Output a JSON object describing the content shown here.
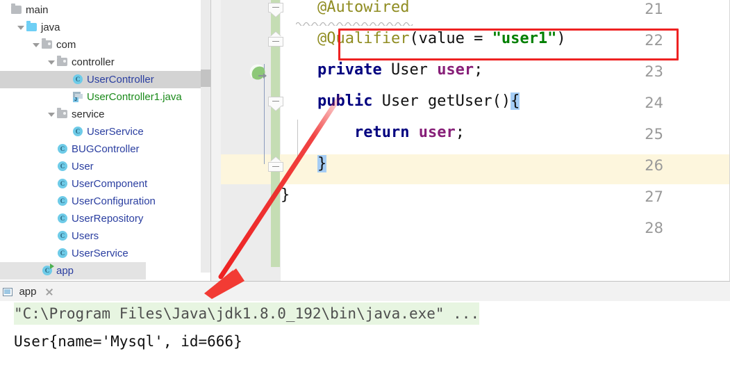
{
  "project_tree": {
    "name": "project-tree",
    "items": [
      {
        "label": "main",
        "icon": "folder-gray-icon",
        "indent": 0,
        "expanded": false,
        "twisty": false,
        "style": "dark",
        "selected": "none"
      },
      {
        "label": "java",
        "icon": "folder-source-icon",
        "indent": 1,
        "expanded": true,
        "twisty": true,
        "style": "dark",
        "selected": "none"
      },
      {
        "label": "com",
        "icon": "folder-package-icon",
        "indent": 2,
        "expanded": true,
        "twisty": true,
        "style": "dark",
        "selected": "none"
      },
      {
        "label": "controller",
        "icon": "folder-package-icon",
        "indent": 3,
        "expanded": true,
        "twisty": true,
        "style": "dark",
        "selected": "none"
      },
      {
        "label": "UserController",
        "icon": "class-icon",
        "indent": 4,
        "expanded": false,
        "twisty": false,
        "style": "blue",
        "selected": "full"
      },
      {
        "label": "UserController1.java",
        "icon": "java-file-icon",
        "indent": 4,
        "expanded": false,
        "twisty": false,
        "style": "green",
        "selected": "none"
      },
      {
        "label": "service",
        "icon": "folder-package-icon",
        "indent": 3,
        "expanded": true,
        "twisty": true,
        "style": "dark",
        "selected": "none"
      },
      {
        "label": "UserService",
        "icon": "class-icon",
        "indent": 4,
        "expanded": false,
        "twisty": false,
        "style": "blue",
        "selected": "none"
      },
      {
        "label": "BUGController",
        "icon": "class-icon",
        "indent": 3,
        "expanded": false,
        "twisty": false,
        "style": "blue",
        "selected": "none"
      },
      {
        "label": "User",
        "icon": "class-icon",
        "indent": 3,
        "expanded": false,
        "twisty": false,
        "style": "blue",
        "selected": "none"
      },
      {
        "label": "UserComponent",
        "icon": "class-icon",
        "indent": 3,
        "expanded": false,
        "twisty": false,
        "style": "blue",
        "selected": "none"
      },
      {
        "label": "UserConfiguration",
        "icon": "class-icon",
        "indent": 3,
        "expanded": false,
        "twisty": false,
        "style": "blue",
        "selected": "none"
      },
      {
        "label": "UserRepository",
        "icon": "class-icon",
        "indent": 3,
        "expanded": false,
        "twisty": false,
        "style": "blue",
        "selected": "none"
      },
      {
        "label": "Users",
        "icon": "class-icon",
        "indent": 3,
        "expanded": false,
        "twisty": false,
        "style": "blue",
        "selected": "none"
      },
      {
        "label": "UserService",
        "icon": "class-icon",
        "indent": 3,
        "expanded": false,
        "twisty": false,
        "style": "blue",
        "selected": "none"
      },
      {
        "label": "app",
        "icon": "class-runnable-icon",
        "indent": 2,
        "expanded": false,
        "twisty": false,
        "style": "blue",
        "selected": "light"
      }
    ]
  },
  "editor": {
    "name": "code-editor",
    "language": "java",
    "line_numbers": [
      "21",
      "22",
      "23",
      "24",
      "25",
      "26",
      "27",
      "28"
    ],
    "lines": [
      {
        "number": "21",
        "text": "    @Autowired",
        "tokens": [
          {
            "t": "    ",
            "c": "plain"
          },
          {
            "t": "@Autowired",
            "c": "annotation"
          }
        ],
        "gutter_icon": "fold-marker-down",
        "underlined": true
      },
      {
        "number": "22",
        "text": "    @Qualifier(value = \"user1\")",
        "tokens": [
          {
            "t": "    ",
            "c": "plain"
          },
          {
            "t": "@Qualifier",
            "c": "annotation"
          },
          {
            "t": "(value = ",
            "c": "plain"
          },
          {
            "t": "\"user1\"",
            "c": "string"
          },
          {
            "t": ")",
            "c": "plain"
          }
        ],
        "gutter_icon": "fold-marker-up",
        "highlighted_box": true
      },
      {
        "number": "23",
        "text": "    private User user;",
        "tokens": [
          {
            "t": "    ",
            "c": "plain"
          },
          {
            "t": "private",
            "c": "keyword"
          },
          {
            "t": " User ",
            "c": "plain"
          },
          {
            "t": "user",
            "c": "field"
          },
          {
            "t": ";",
            "c": "plain"
          }
        ],
        "gutter_icon": "spring-bean-icon"
      },
      {
        "number": "24",
        "text": "    public User getUser(){",
        "tokens": [
          {
            "t": "    ",
            "c": "plain"
          },
          {
            "t": "public",
            "c": "keyword"
          },
          {
            "t": " User getUser()",
            "c": "plain"
          },
          {
            "t": "{",
            "c": "brace-match"
          }
        ],
        "gutter_icon": "fold-marker-down"
      },
      {
        "number": "25",
        "text": "        return user;",
        "tokens": [
          {
            "t": "        ",
            "c": "plain"
          },
          {
            "t": "return",
            "c": "keyword"
          },
          {
            "t": " ",
            "c": "plain"
          },
          {
            "t": "user",
            "c": "field"
          },
          {
            "t": ";",
            "c": "plain"
          }
        ],
        "gutter_icon": ""
      },
      {
        "number": "26",
        "text": "    }",
        "tokens": [
          {
            "t": "    ",
            "c": "plain"
          },
          {
            "t": "}",
            "c": "brace-match"
          }
        ],
        "gutter_icon": "fold-marker-up",
        "current_line": true
      },
      {
        "number": "27",
        "text": "}",
        "tokens": [
          {
            "t": "}",
            "c": "plain"
          }
        ],
        "gutter_icon": ""
      },
      {
        "number": "28",
        "text": "",
        "tokens": [],
        "gutter_icon": ""
      }
    ]
  },
  "console": {
    "name": "run-console",
    "tab": {
      "label": "app",
      "icon": "console-window-icon",
      "close_icon": "close-icon",
      "active": true
    },
    "output": [
      {
        "text": "\"C:\\Program Files\\Java\\jdk1.8.0_192\\bin\\java.exe\" ...",
        "style": "command"
      },
      {
        "text": "User{name='Mysql', id=666}",
        "style": "output"
      }
    ]
  },
  "annotations": {
    "red_box_target": "@Qualifier(value = \"user1\")",
    "red_arrow": {
      "from": "code-line-24",
      "to": "console-output-area"
    }
  },
  "colors": {
    "annotation_red": "#ee2222",
    "selection_gray": "#d3d3d3",
    "current_line_yellow": "#fdf6dd",
    "vcs_green": "#c5ddb4",
    "console_command_green": "#e7f5e1",
    "string_green": "#008000",
    "keyword_navy": "#00007f",
    "annotation_olive": "#8f8c21",
    "field_purple": "#871f78",
    "class_blue": "#2a3ea0",
    "java_file_green": "#1a8a1a",
    "brace_match_blue": "#a5cdf5"
  }
}
